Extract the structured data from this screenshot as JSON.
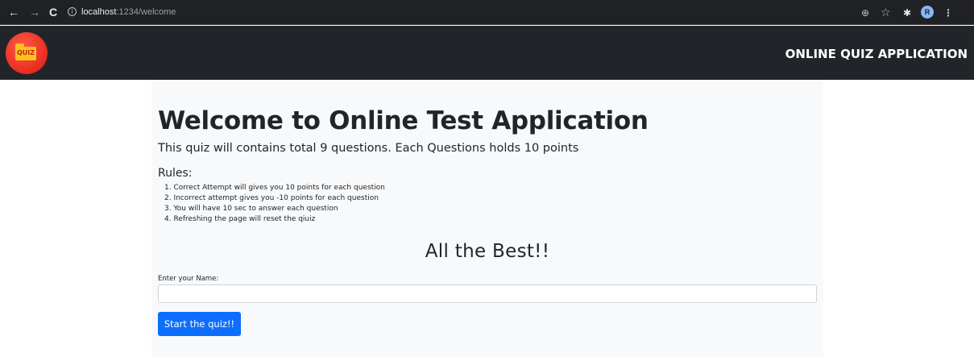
{
  "browser": {
    "back_icon": "←",
    "forward_icon": "→",
    "reload_icon": "C",
    "info_icon": "i",
    "url_host": "localhost",
    "url_path": ":1234/welcome",
    "zoom_icon": "⊕",
    "star_icon": "☆",
    "extension_icon": "✱",
    "profile_initial": "R",
    "menu_icon": "⋮"
  },
  "navbar": {
    "logo_text": "QUIZ",
    "title": "ONLINE QUIZ APPLICATION",
    "bg_color": "#212529"
  },
  "main": {
    "heading": "Welcome to Online Test Application",
    "subtitle": "This quiz will contains total 9 questions. Each Questions holds 10 points",
    "rules_title": "Rules:",
    "rules": [
      "1. Correct Attempt will gives you 10 points for each question",
      "2. Incorrect attempt gives you -10 points for each question",
      "3. You will have 10 sec to answer each question",
      "4. Refreshing the page will reset the qiuiz"
    ],
    "closing": "All the Best!!",
    "name_label": "Enter your Name:",
    "name_value": "",
    "start_button": "Start the quiz!!",
    "button_color": "#0d6efd"
  }
}
